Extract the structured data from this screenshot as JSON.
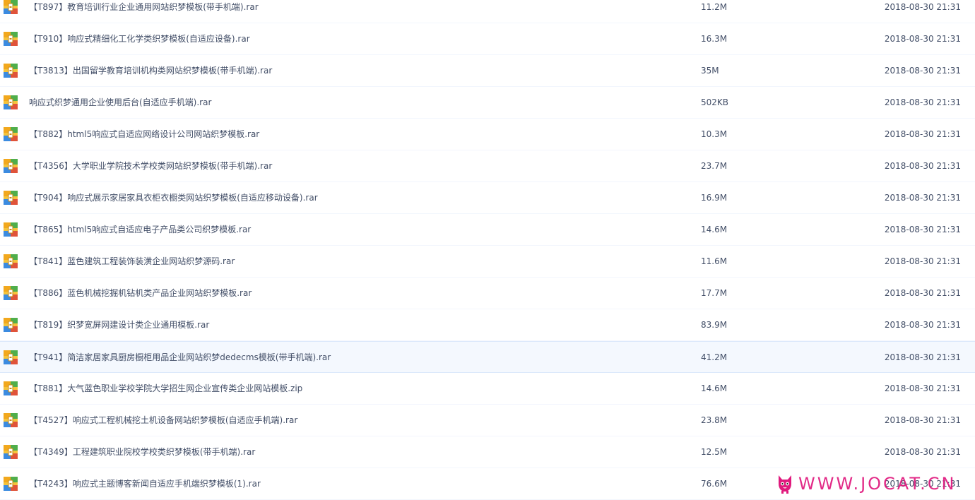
{
  "files": [
    {
      "name": "【T897】教育培训行业企业通用网站织梦模板(带手机端).rar",
      "size": "11.2M",
      "date": "2018-08-30 21:31"
    },
    {
      "name": "【T910】响应式精细化工化学类织梦模板(自适应设备).rar",
      "size": "16.3M",
      "date": "2018-08-30 21:31"
    },
    {
      "name": "【T3813】出国留学教育培训机构类网站织梦模板(带手机端).rar",
      "size": "35M",
      "date": "2018-08-30 21:31"
    },
    {
      "name": "响应式织梦通用企业使用后台(自适应手机端).rar",
      "size": "502KB",
      "date": "2018-08-30 21:31"
    },
    {
      "name": "【T882】html5响应式自适应网络设计公司网站织梦模板.rar",
      "size": "10.3M",
      "date": "2018-08-30 21:31"
    },
    {
      "name": "【T4356】大学职业学院技术学校类网站织梦模板(带手机端).rar",
      "size": "23.7M",
      "date": "2018-08-30 21:31"
    },
    {
      "name": "【T904】响应式展示家居家具衣柜衣橱类网站织梦模板(自适应移动设备).rar",
      "size": "16.9M",
      "date": "2018-08-30 21:31"
    },
    {
      "name": "【T865】html5响应式自适应电子产品类公司织梦模板.rar",
      "size": "14.6M",
      "date": "2018-08-30 21:31"
    },
    {
      "name": "【T841】蓝色建筑工程装饰装潢企业网站织梦源码.rar",
      "size": "11.6M",
      "date": "2018-08-30 21:31"
    },
    {
      "name": "【T886】蓝色机械挖掘机钻机类产品企业网站织梦模板.rar",
      "size": "17.7M",
      "date": "2018-08-30 21:31"
    },
    {
      "name": "【T819】织梦宽屏网建设计类企业通用模板.rar",
      "size": "83.9M",
      "date": "2018-08-30 21:31"
    },
    {
      "name": "【T941】简洁家居家具厨房橱柜用品企业网站织梦dedecms模板(带手机端).rar",
      "size": "41.2M",
      "date": "2018-08-30 21:31"
    },
    {
      "name": "【T881】大气蓝色职业学校学院大学招生网企业宣传类企业网站模板.zip",
      "size": "14.6M",
      "date": "2018-08-30 21:31"
    },
    {
      "name": "【T4527】响应式工程机械挖土机设备网站织梦模板(自适应手机端).rar",
      "size": "23.8M",
      "date": "2018-08-30 21:31"
    },
    {
      "name": "【T4349】工程建筑职业院校学校类织梦模板(带手机端).rar",
      "size": "12.5M",
      "date": "2018-08-30 21:31"
    },
    {
      "name": "【T4243】响应式主题博客新闻自适应手机端织梦模板(1).rar",
      "size": "76.6M",
      "date": "2018-08-30 21:31"
    }
  ],
  "hovered_row": 11,
  "watermark": {
    "text": "WWW.JOCAT.CN",
    "color": "#e0197d"
  },
  "icon": {
    "name": "archive-icon",
    "colors": [
      "#f2a81d",
      "#4fae4b",
      "#e0533a",
      "#3b8be0"
    ]
  }
}
